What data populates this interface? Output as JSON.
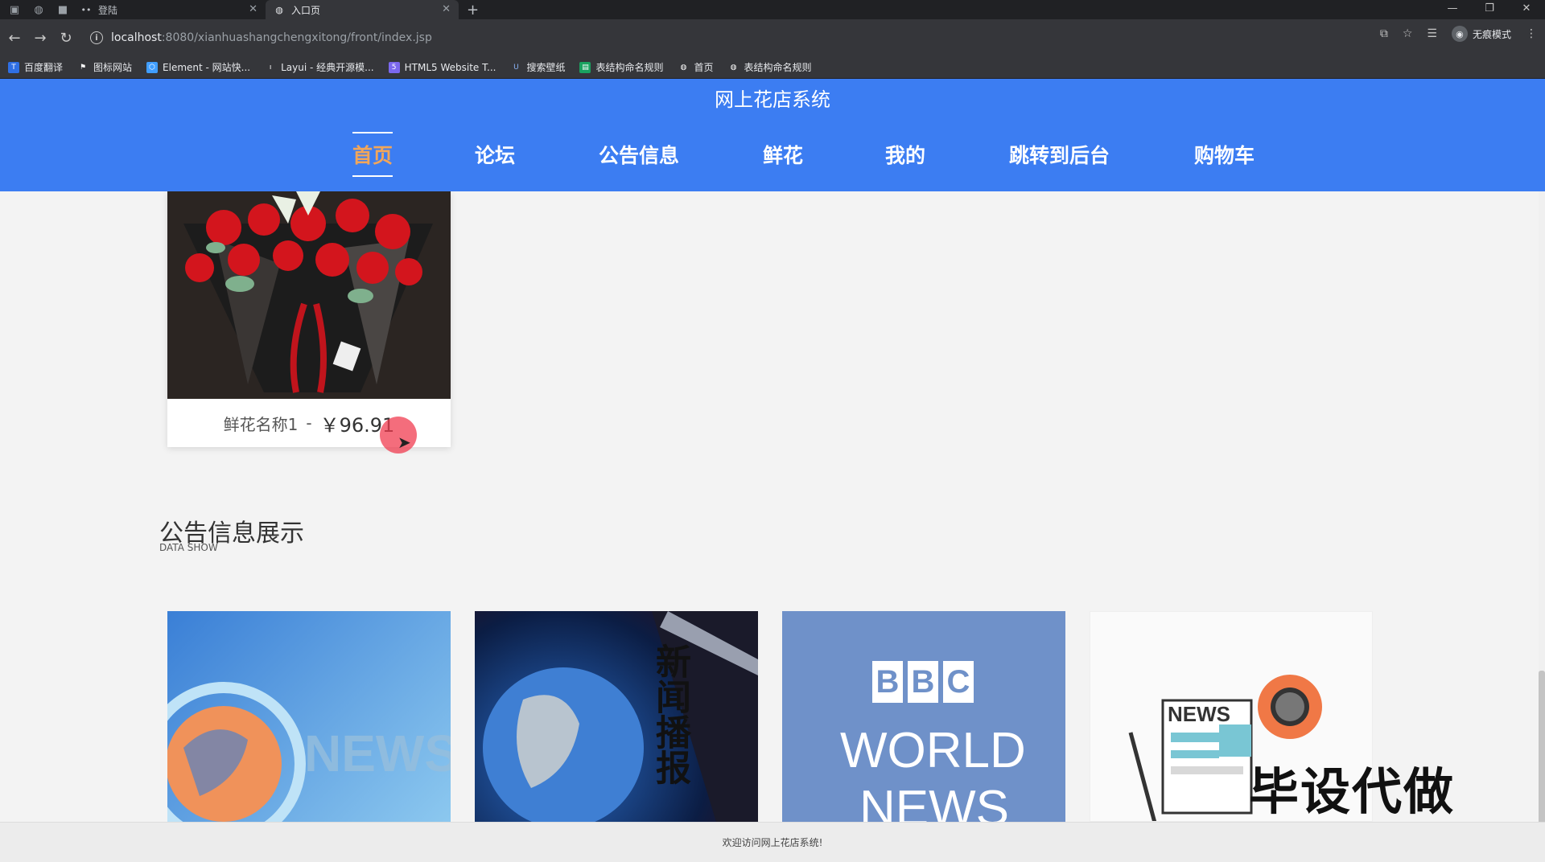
{
  "browser": {
    "tabs": [
      {
        "title": "登陆"
      },
      {
        "title": "入口页"
      }
    ],
    "url_host": "localhost",
    "url_path": ":8080/xianhuashangchengxitong/front/index.jsp",
    "incognito_label": "无痕模式",
    "bookmarks": [
      {
        "label": "百度翻译",
        "icon": "translate-icon",
        "color": "#2f6fe4"
      },
      {
        "label": "图标网站",
        "icon": "flag-icon",
        "color": "#444444"
      },
      {
        "label": "Element - 网站快...",
        "icon": "element-icon",
        "color": "#409eff"
      },
      {
        "label": "Layui - 经典开源模...",
        "icon": "layui-icon",
        "color": "#555555"
      },
      {
        "label": "HTML5 Website T...",
        "icon": "html5-icon",
        "color": "#7b68ee"
      },
      {
        "label": "搜索壁纸",
        "icon": "wallpaper-icon",
        "color": "#3b5998"
      },
      {
        "label": "表结构命名规则",
        "icon": "table-icon",
        "color": "#1aa260"
      },
      {
        "label": "首页",
        "icon": "globe-icon",
        "color": "#666666"
      },
      {
        "label": "表结构命名规则",
        "icon": "globe-icon",
        "color": "#666666"
      }
    ]
  },
  "site": {
    "title": "网上花店系统",
    "nav": [
      {
        "label": "首页",
        "active": true
      },
      {
        "label": "论坛",
        "active": false
      },
      {
        "label": "公告信息",
        "active": false
      },
      {
        "label": "鲜花",
        "active": false
      },
      {
        "label": "我的",
        "active": false
      },
      {
        "label": "跳转到后台",
        "active": false
      },
      {
        "label": "购物车",
        "active": false
      }
    ],
    "accent": "#3c7df2",
    "active_color": "#f2a65a"
  },
  "flower": {
    "name": "鲜花名称1",
    "separator": "-",
    "price": "￥96.91"
  },
  "notice_section": {
    "title": "公告信息展示",
    "subtitle": "DATA SHOW"
  },
  "news_cards": {
    "card1_text": "NEWS",
    "card2_text": "新闻播报",
    "card3_b1": "B",
    "card3_b2": "B",
    "card3_b3": "C",
    "card3_world": "WORLD",
    "card3_news": "NEWS",
    "card4_text": "NEWS"
  },
  "watermark": "毕设代做",
  "footer": "欢迎访问网上花店系统!"
}
